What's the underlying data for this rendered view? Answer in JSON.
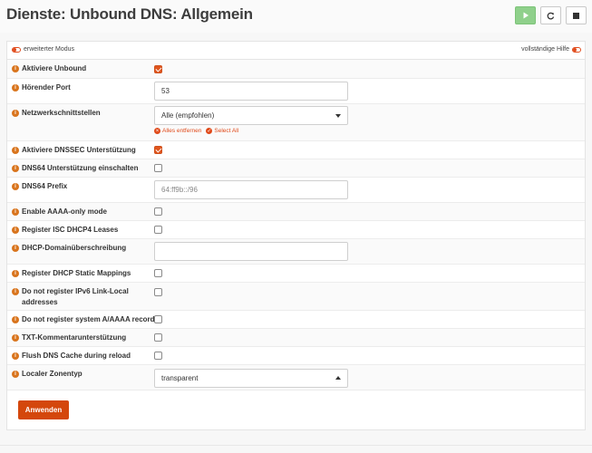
{
  "page": {
    "title": "Dienste: Unbound DNS: Allgemein"
  },
  "service_buttons": [
    {
      "icon": "play-icon",
      "color": "#8fd08b"
    },
    {
      "icon": "refresh-icon"
    },
    {
      "icon": "stop-icon"
    }
  ],
  "toolbar": {
    "advanced_mode_label": "erweiterter Modus",
    "full_help_label": "vollständige Hilfe"
  },
  "form": {
    "enable_unbound": {
      "label": "Aktiviere Unbound",
      "checked": true
    },
    "listen_port": {
      "label": "Hörender Port",
      "value": "53"
    },
    "interfaces": {
      "label": "Netzwerkschnittstellen",
      "value": "Alle (empfohlen)",
      "clear_all": "Alles entfernen",
      "select_all": "Select All"
    },
    "dnssec": {
      "label": "Aktiviere DNSSEC Unterstützung",
      "checked": true
    },
    "dns64": {
      "label": "DNS64 Unterstützung einschalten",
      "checked": false
    },
    "dns64_prefix": {
      "label": "DNS64 Prefix",
      "placeholder": "64:ff9b::/96"
    },
    "aaaa_only": {
      "label": "Enable AAAA-only mode",
      "checked": false
    },
    "register_dhcp4": {
      "label": "Register ISC DHCP4 Leases",
      "checked": false
    },
    "dhcp_domain_override": {
      "label": "DHCP-Domainüberschreibung",
      "value": ""
    },
    "register_static": {
      "label": "Register DHCP Static Mappings",
      "checked": false
    },
    "no_ipv6_linklocal": {
      "label_line1": "Do not register IPv6 Link-Local",
      "label_line2": "addresses",
      "checked": false
    },
    "no_system_records": {
      "label": "Do not register system A/AAAA records",
      "checked": false
    },
    "txt_support": {
      "label": "TXT-Kommentarunterstützung",
      "checked": false
    },
    "flush_cache": {
      "label": "Flush DNS Cache during reload",
      "checked": false
    },
    "local_zone_type": {
      "label": "Localer Zonentyp",
      "value": "transparent"
    }
  },
  "apply_button": {
    "label": "Anwenden",
    "color": "#d4470c"
  },
  "colors": {
    "accent": "#e04a1a",
    "info": "#d9751e"
  }
}
